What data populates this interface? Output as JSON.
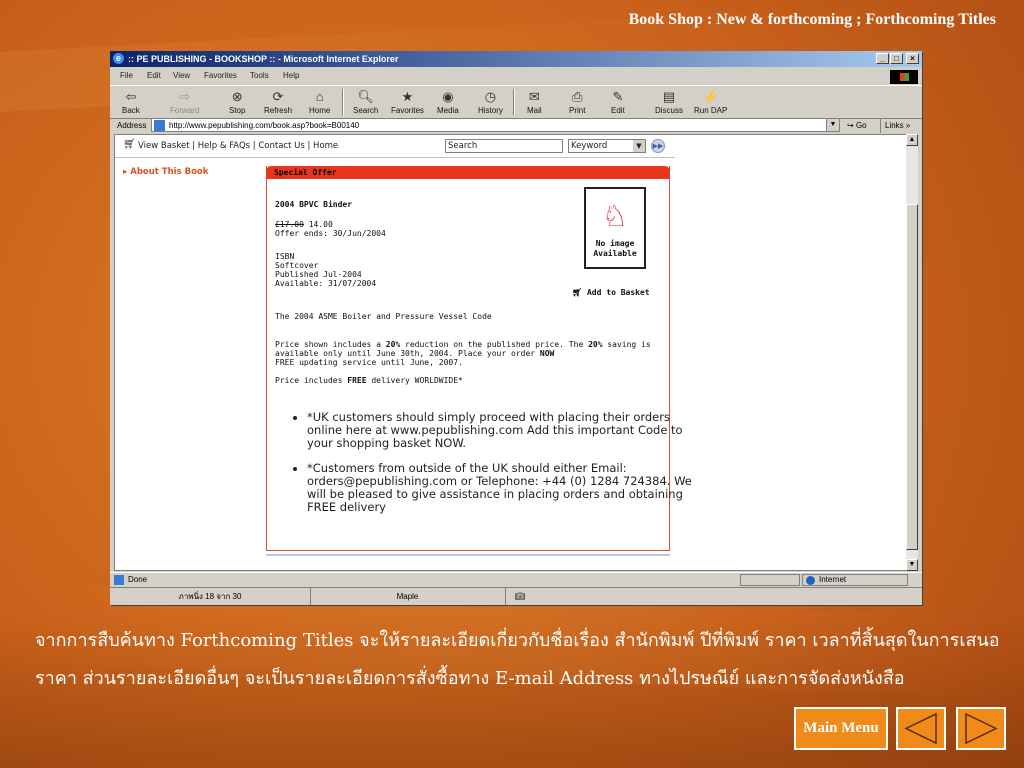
{
  "slide": {
    "title": "Book Shop : New & forthcoming ; Forthcoming Titles",
    "caption": "จากการสืบค้นทาง Forthcoming Titles จะให้รายละเอียดเกี่ยวกับชื่อเรื่อง สำนักพิมพ์ ปีที่พิมพ์ ราคา เวลาที่สิ้นสุดในการเสนอราคา ส่วนรายละเอียดอื่นๆ จะเป็นรายละเอียดการสั่งซื้อทาง E-mail Address ทางไปรษณีย์ และการจัดส่งหนังสือ",
    "main_menu": "Main Menu"
  },
  "browser": {
    "window_title": ":: PE PUBLISHING - BOOKSHOP :: - Microsoft Internet Explorer",
    "menu": [
      "File",
      "Edit",
      "View",
      "Favorites",
      "Tools",
      "Help"
    ],
    "toolbar": [
      "Back",
      "Forward",
      "Stop",
      "Refresh",
      "Home",
      "Search",
      "Favorites",
      "Media",
      "History",
      "Mail",
      "Print",
      "Edit",
      "Discuss",
      "Run DAP"
    ],
    "address_label": "Address",
    "url": "http://www.pepublishing.com/book.asp?book=B00140",
    "go": "Go",
    "links": "Links »",
    "status": "Done",
    "zone": "Internet",
    "taskbar": [
      "ภาพนิ่ง 18 จาก 30",
      "Maple"
    ]
  },
  "page": {
    "topnav": "View Basket | Help & FAQs | Contact Us | Home",
    "search_placeholder": "Search",
    "keyword": "Keyword",
    "sidebar_item": "About This Book",
    "offer_header": "Special Offer",
    "book_title": "2004 BPVC Binder",
    "old_price": "£17.00",
    "new_price": "14.00",
    "offer_ends": "Offer ends: 30/Jun/2004",
    "isbn": "ISBN",
    "format": "Softcover",
    "published": "Published Jul-2004",
    "available": "Available: 31/07/2004",
    "no_image": "No image",
    "no_image_2": "Available",
    "add_to_basket": "Add to Basket",
    "description": "The 2004 ASME Boiler and Pressure Vessel Code",
    "price_note_a": "Price shown includes a ",
    "price_note_b": "20%",
    "price_note_c": " reduction on the published price. The ",
    "price_note_d": "20%",
    "price_note_e": " saving is",
    "price_note_2a": "available only until June 30th, 2004. Place your order ",
    "price_note_2b": "NOW",
    "price_note_3": "FREE updating service until June, 2007.",
    "delivery_a": "Price includes ",
    "delivery_b": "FREE",
    "delivery_c": " delivery WORLDWIDE*",
    "bullet_1": "*UK customers should simply proceed with placing their orders online here at www.pepublishing.com Add this important Code to your shopping basket NOW.",
    "bullet_2": "*Customers from outside of the UK should either Email: orders@pepublishing.com or Telephone: +44 (0) 1284 724384. We will be pleased to give assistance in placing orders and obtaining FREE delivery"
  },
  "icons": {
    "back": "back-arrow-icon",
    "forward": "forward-arrow-icon",
    "stop": "stop-icon",
    "refresh": "refresh-icon",
    "home": "home-icon",
    "search": "search-icon",
    "favorites": "favorites-icon",
    "media": "media-icon",
    "history": "history-icon",
    "mail": "mail-icon",
    "print": "print-icon",
    "edit": "edit-icon",
    "discuss": "discuss-icon",
    "rundap": "run-dap-icon",
    "cart": "cart-icon",
    "prev": "previous-triangle-icon",
    "next": "next-triangle-icon"
  },
  "colors": {
    "accent": "#e8351c",
    "nav_button": "#f08a18"
  }
}
